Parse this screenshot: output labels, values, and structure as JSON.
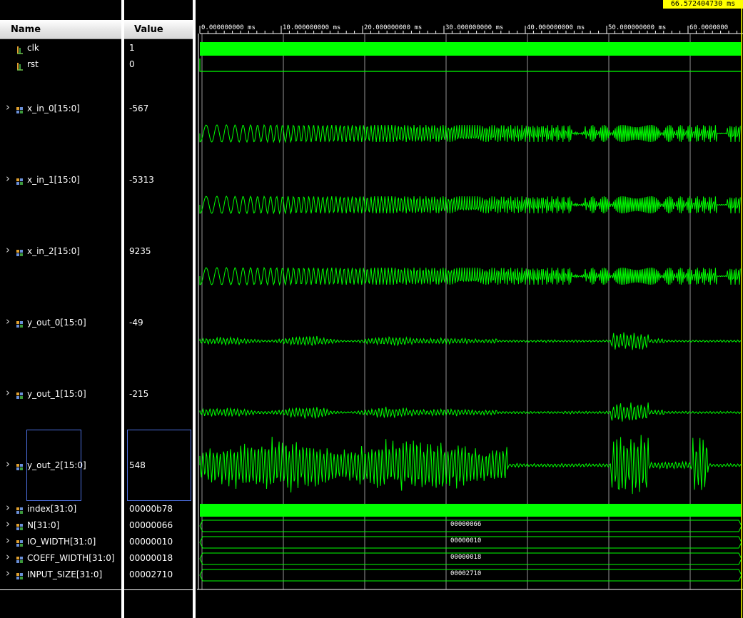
{
  "columns": {
    "name": "Name",
    "value": "Value"
  },
  "cursor_time": "66.572404730 ms",
  "time_ticks": [
    "0.000000000 ms",
    "10.000000000 ms",
    "20.000000000 ms",
    "30.000000000 ms",
    "40.000000000 ms",
    "50.000000000 ms",
    "60.0000000"
  ],
  "signals": [
    {
      "name": "clk",
      "value": "1",
      "kind": "bit"
    },
    {
      "name": "rst",
      "value": "0",
      "kind": "bit"
    },
    {
      "name": "x_in_0[15:0]",
      "value": "-567",
      "kind": "analog"
    },
    {
      "name": "x_in_1[15:0]",
      "value": "-5313",
      "kind": "analog"
    },
    {
      "name": "x_in_2[15:0]",
      "value": "9235",
      "kind": "analog"
    },
    {
      "name": "y_out_0[15:0]",
      "value": "-49",
      "kind": "analog"
    },
    {
      "name": "y_out_1[15:0]",
      "value": "-215",
      "kind": "analog"
    },
    {
      "name": "y_out_2[15:0]",
      "value": "548",
      "kind": "analog"
    },
    {
      "name": "index[31:0]",
      "value": "00000b78",
      "kind": "bus"
    },
    {
      "name": "N[31:0]",
      "value": "00000066",
      "kind": "bus",
      "bus_label": "00000066"
    },
    {
      "name": "IO_WIDTH[31:0]",
      "value": "00000010",
      "kind": "bus",
      "bus_label": "00000010"
    },
    {
      "name": "COEFF_WIDTH[31:0]",
      "value": "00000018",
      "kind": "bus",
      "bus_label": "00000018"
    },
    {
      "name": "INPUT_SIZE[31:0]",
      "value": "00002710",
      "kind": "bus",
      "bus_label": "00002710"
    }
  ],
  "colors": {
    "wave": "#00ff00",
    "cursor": "#ffff00",
    "background": "#000000",
    "grid": "#ffffff",
    "selection": "#4d6fe0"
  },
  "icons": {
    "bit": "bit-signal-icon",
    "bus": "bus-signal-icon",
    "expand": "chevron-right-icon"
  }
}
